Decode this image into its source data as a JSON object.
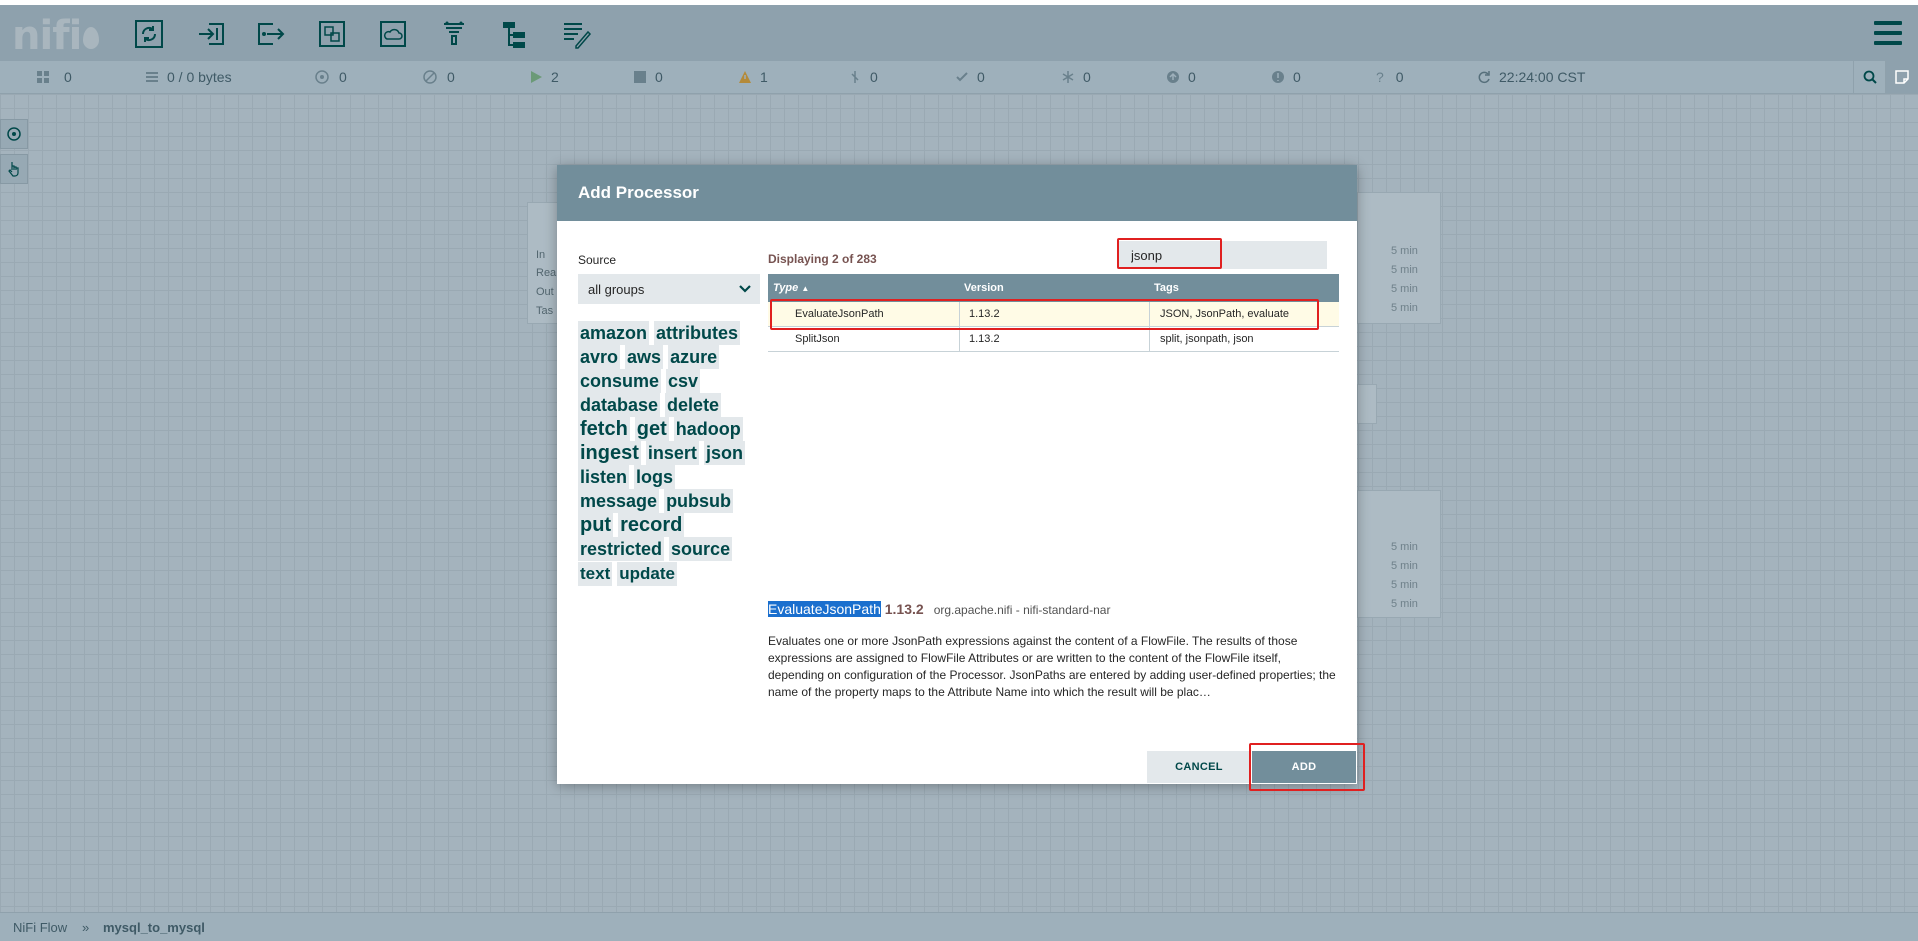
{
  "app": {
    "logo_text": "nifi",
    "toolbar": [
      {
        "name": "processor-icon"
      },
      {
        "name": "input-port-icon"
      },
      {
        "name": "output-port-icon"
      },
      {
        "name": "process-group-icon"
      },
      {
        "name": "remote-process-group-icon"
      },
      {
        "name": "funnel-icon"
      },
      {
        "name": "template-icon"
      },
      {
        "name": "label-icon"
      }
    ]
  },
  "status": {
    "transmitting": "0",
    "queued": "0 / 0 bytes",
    "transmitting_rpg": "0",
    "not_transmitting_rpg": "0",
    "running": "2",
    "stopped": "0",
    "invalid": "1",
    "disabled": "0",
    "up_to_date": "0",
    "locally_modified": "0",
    "stale": "0",
    "locally_modified_stale": "0",
    "sync_failure": "0",
    "last_refresh": "22:24:00 CST"
  },
  "canvas": {
    "ghost_labels": [
      "In",
      "Rea",
      "Out",
      "Tas"
    ],
    "ghost_min": "5 min"
  },
  "breadcrumb": {
    "root": "NiFi Flow",
    "sep": "»",
    "current": "mysql_to_mysql"
  },
  "dialog": {
    "title": "Add Processor",
    "source_label": "Source",
    "source_value": "all groups",
    "tags": [
      "amazon",
      "attributes",
      "avro",
      "aws",
      "azure",
      "consume",
      "csv",
      "database",
      "delete",
      "fetch",
      "get",
      "hadoop",
      "ingest",
      "insert",
      "json",
      "listen",
      "logs",
      "message",
      "pubsub",
      "put",
      "record",
      "restricted",
      "source",
      "text",
      "update"
    ],
    "displaying": "Displaying 2 of 283",
    "filter_value": "jsonp",
    "columns": {
      "type": "Type",
      "version": "Version",
      "tags": "Tags"
    },
    "rows": [
      {
        "type": "EvaluateJsonPath",
        "version": "1.13.2",
        "tags": "JSON, JsonPath, evaluate"
      },
      {
        "type": "SplitJson",
        "version": "1.13.2",
        "tags": "split, jsonpath, json"
      }
    ],
    "selected": {
      "name": "EvaluateJsonPath",
      "version": "1.13.2",
      "bundle": "org.apache.nifi - nifi-standard-nar",
      "description": "Evaluates one or more JsonPath expressions against the content of a FlowFile. The results of those expressions are assigned to FlowFile Attributes or are written to the content of the FlowFile itself, depending on configuration of the Processor. JsonPaths are entered by adding user-defined properties; the name of the property maps to the Attribute Name into which the result will be plac…"
    },
    "cancel_label": "CANCEL",
    "add_label": "ADD",
    "highlight_color": "#e02020"
  }
}
